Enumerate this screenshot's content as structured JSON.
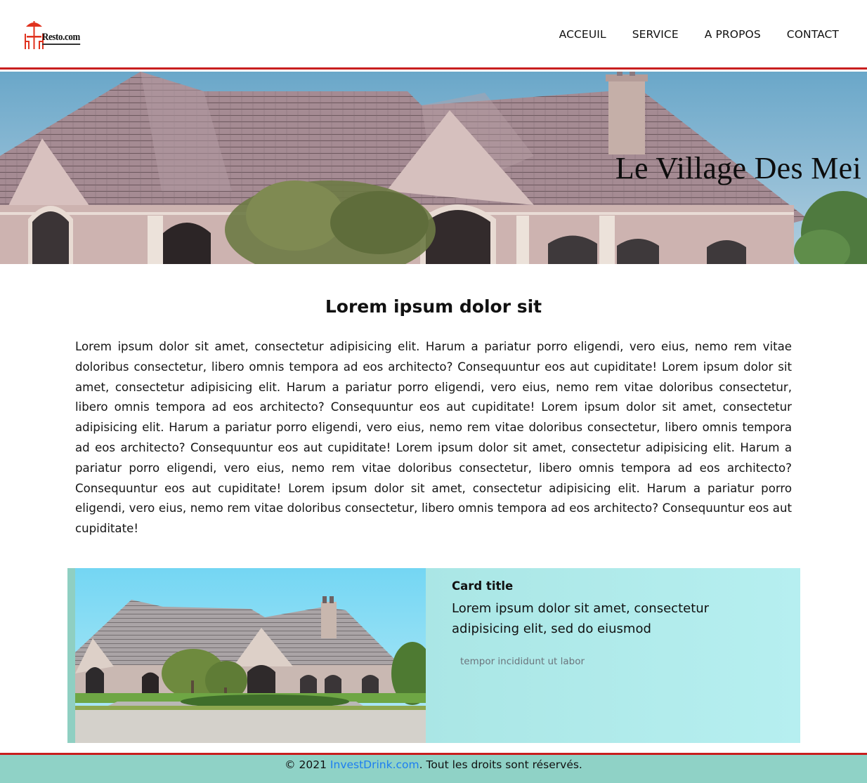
{
  "header": {
    "logo_text": "Resto.com",
    "nav": [
      {
        "label": "ACCEUIL"
      },
      {
        "label": "SERVICE"
      },
      {
        "label": "A PROPOS"
      },
      {
        "label": "CONTACT"
      }
    ]
  },
  "hero": {
    "title": "Le Village Des Mei"
  },
  "main": {
    "title": "Lorem ipsum dolor sit",
    "paragraph": "Lorem ipsum dolor sit amet, consectetur adipisicing elit. Harum a pariatur porro eligendi, vero eius, nemo rem vitae doloribus consectetur, libero omnis tempora ad eos architecto? Consequuntur eos aut cupiditate! Lorem ipsum dolor sit amet, consectetur adipisicing elit. Harum a pariatur porro eligendi, vero eius, nemo rem vitae doloribus consectetur, libero omnis tempora ad eos architecto? Consequuntur eos aut cupiditate! Lorem ipsum dolor sit amet, consectetur adipisicing elit. Harum a pariatur porro eligendi, vero eius, nemo rem vitae doloribus consectetur, libero omnis tempora ad eos architecto? Consequuntur eos aut cupiditate! Lorem ipsum dolor sit amet, consectetur adipisicing elit. Harum a pariatur porro eligendi, vero eius, nemo rem vitae doloribus consectetur, libero omnis tempora ad eos architecto? Consequuntur eos aut cupiditate! Lorem ipsum dolor sit amet, consectetur adipisicing elit. Harum a pariatur porro eligendi, vero eius, nemo rem vitae doloribus consectetur, libero omnis tempora ad eos architecto? Consequuntur eos aut cupiditate!"
  },
  "card": {
    "title": "Card title",
    "text": "Lorem ipsum dolor sit amet, consectetur adipisicing elit, sed do eiusmod",
    "muted": "tempor incididunt ut labor"
  },
  "footer": {
    "prefix": "© 2021 ",
    "link": "InvestDrink.com",
    "suffix": ". Tout les droits sont réservés."
  },
  "colors": {
    "accent_red": "#c81e1e",
    "footer_bg": "#8fd2c6",
    "card_bg": "#b6eff0",
    "link": "#1d7ef0"
  }
}
